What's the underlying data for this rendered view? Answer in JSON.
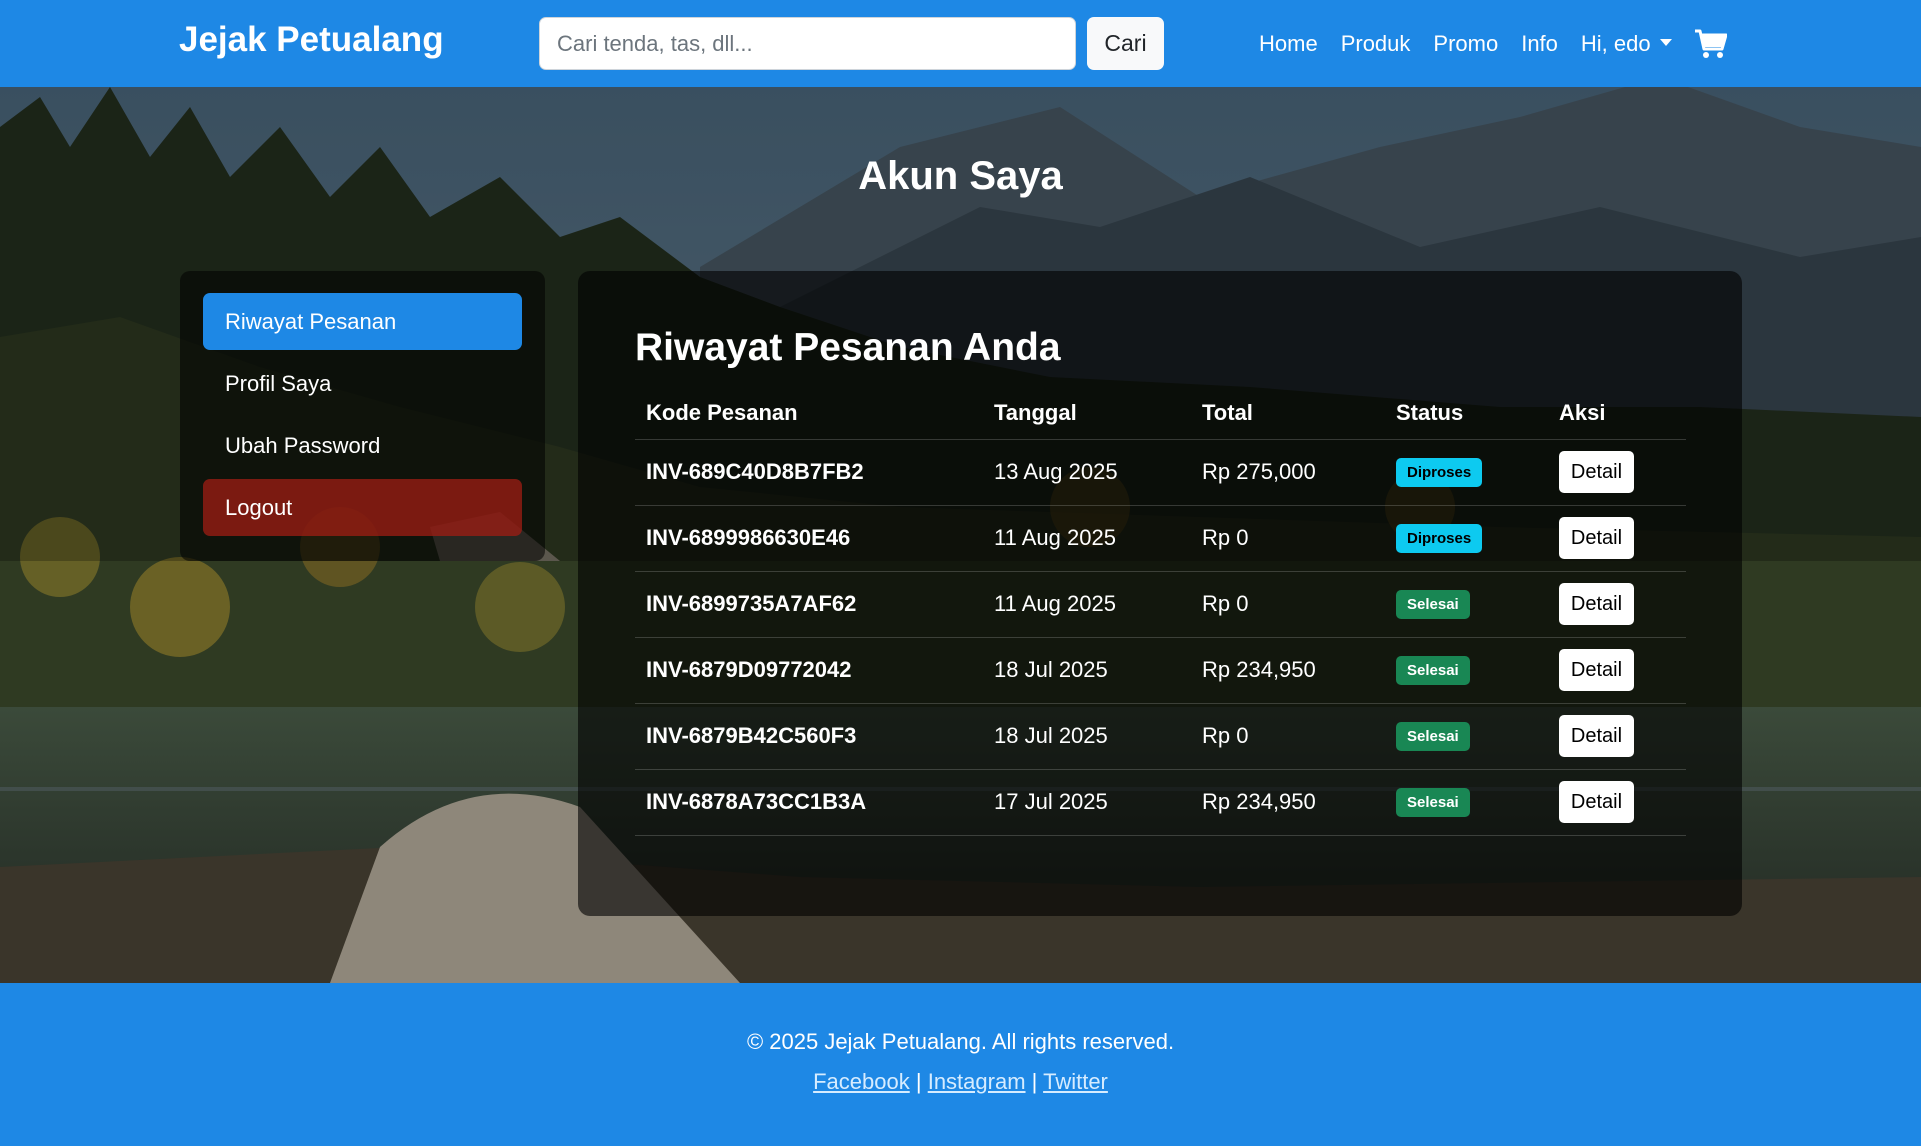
{
  "navbar": {
    "brand": "Jejak Petualang",
    "search_placeholder": "Cari tenda, tas, dll...",
    "search_button": "Cari",
    "links": [
      "Home",
      "Produk",
      "Promo",
      "Info"
    ],
    "user_menu": "Hi, edo"
  },
  "page": {
    "title": "Akun Saya"
  },
  "sidebar": {
    "items": [
      {
        "label": "Riwayat Pesanan"
      },
      {
        "label": "Profil Saya"
      },
      {
        "label": "Ubah Password"
      },
      {
        "label": "Logout"
      }
    ]
  },
  "orders": {
    "title": "Riwayat Pesanan Anda",
    "headers": [
      "Kode Pesanan",
      "Tanggal",
      "Total",
      "Status",
      "Aksi"
    ],
    "detail_label": "Detail",
    "rows": [
      {
        "code": "INV-689C40D8B7FB2",
        "date": "13 Aug 2025",
        "total": "Rp 275,000",
        "status": "Diproses"
      },
      {
        "code": "INV-6899986630E46",
        "date": "11 Aug 2025",
        "total": "Rp 0",
        "status": "Diproses"
      },
      {
        "code": "INV-6899735A7AF62",
        "date": "11 Aug 2025",
        "total": "Rp 0",
        "status": "Selesai"
      },
      {
        "code": "INV-6879D09772042",
        "date": "18 Jul 2025",
        "total": "Rp 234,950",
        "status": "Selesai"
      },
      {
        "code": "INV-6879B42C560F3",
        "date": "18 Jul 2025",
        "total": "Rp 0",
        "status": "Selesai"
      },
      {
        "code": "INV-6878A73CC1B3A",
        "date": "17 Jul 2025",
        "total": "Rp 234,950",
        "status": "Selesai"
      }
    ]
  },
  "footer": {
    "copyright": "© 2025 Jejak Petualang. All rights reserved.",
    "links": [
      "Facebook",
      "Instagram",
      "Twitter"
    ],
    "separator": "|"
  },
  "colors": {
    "primary": "#1e88e5",
    "badge_processing": "#0dcaf0",
    "badge_done": "#198754",
    "logout": "#a01e14"
  }
}
